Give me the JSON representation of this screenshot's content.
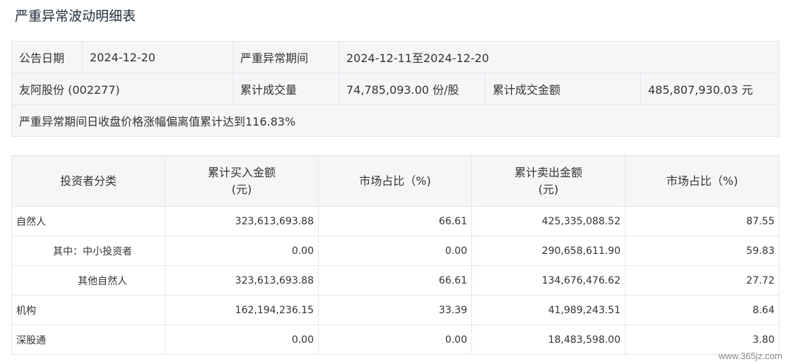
{
  "title": "严重异常波动明细表",
  "summary": {
    "announce_date_label": "公告日期",
    "announce_date": "2024-12-20",
    "period_label": "严重异常期间",
    "period": "2024-12-11至2024-12-20",
    "stock": "友阿股份 (002277)",
    "volume_label": "累计成交量",
    "volume": "74,785,093.00 份/股",
    "amount_label": "累计成交金额",
    "amount": "485,807,930.03 元",
    "note": "严重异常期间日收盘价格涨幅偏离值累计达到116.83%"
  },
  "detail": {
    "headers": {
      "category": "投资者分类",
      "buy_line1": "累计买入金额",
      "buy_line2": "(元)",
      "buy_share": "市场占比（%)",
      "sell_line1": "累计卖出金额",
      "sell_line2": "(元)",
      "sell_share": "市场占比（%)"
    },
    "rows": [
      {
        "category": "自然人",
        "buy": "323,613,693.88",
        "buy_share": "66.61",
        "sell": "425,335,088.52",
        "sell_share": "87.55"
      },
      {
        "category": "其中：中小投资者",
        "buy": "0.00",
        "buy_share": "0.00",
        "sell": "290,658,611.90",
        "sell_share": "59.83"
      },
      {
        "category": "其他自然人",
        "buy": "323,613,693.88",
        "buy_share": "66.61",
        "sell": "134,676,476.62",
        "sell_share": "27.72"
      },
      {
        "category": "机构",
        "buy": "162,194,236.15",
        "buy_share": "33.39",
        "sell": "41,989,243.51",
        "sell_share": "8.64"
      },
      {
        "category": "深股通",
        "buy": "0.00",
        "buy_share": "0.00",
        "sell": "18,483,598.00",
        "sell_share": "3.80"
      }
    ]
  },
  "watermark": "www.365jz.com"
}
